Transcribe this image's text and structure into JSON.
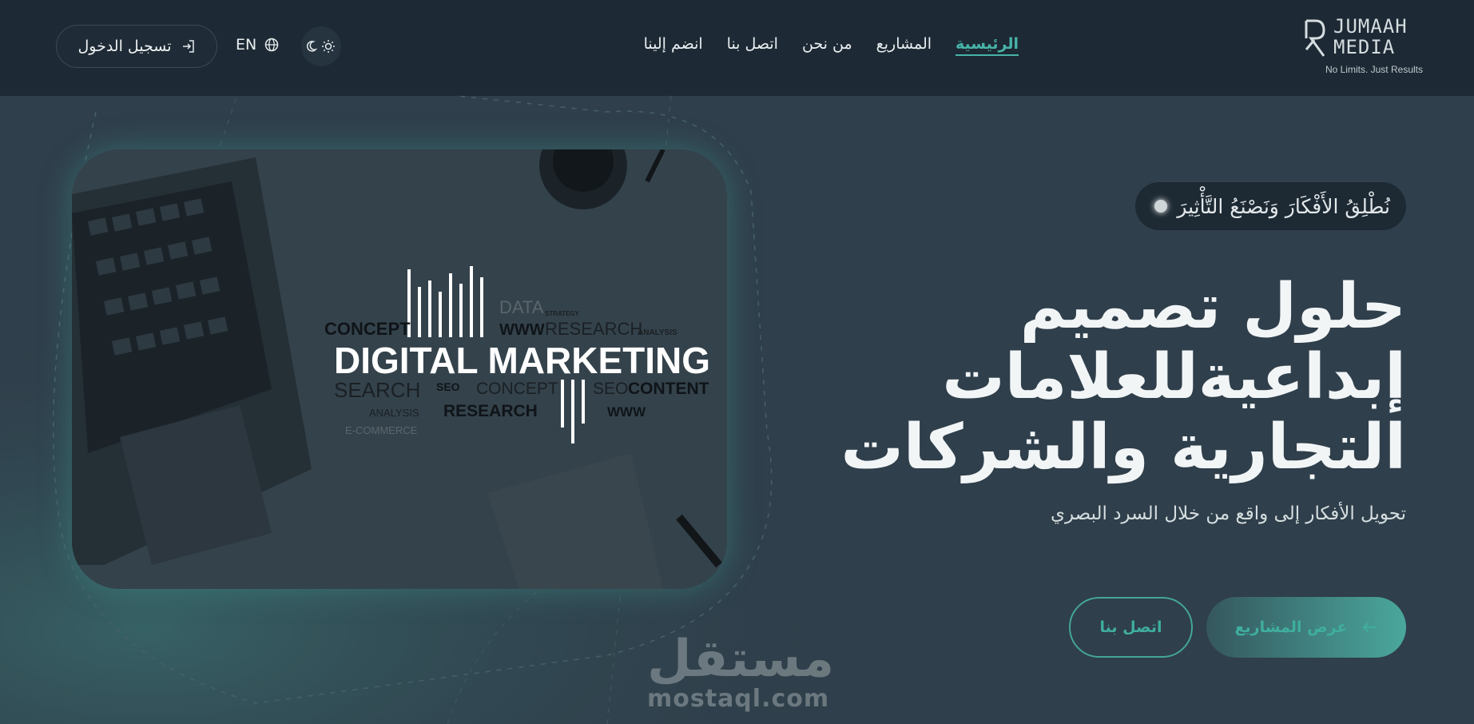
{
  "brand": {
    "name_line1": "JUMAAH",
    "name_line2": "MEDIA",
    "tagline": "No Limits. Just Results"
  },
  "nav": {
    "items": [
      {
        "label": "الرئيسية",
        "active": true
      },
      {
        "label": "المشاريع"
      },
      {
        "label": "من نحن"
      },
      {
        "label": "اتصل بنا"
      },
      {
        "label": "انضم إلينا"
      }
    ],
    "language": "EN",
    "login_label": "تسجيل الدخول"
  },
  "hero": {
    "badge": "نُطْلِقُ الأَفْكَارَ وَنَصْنَعُ التَّأْثِيرَ",
    "title_lines": [
      "حلول تصميم",
      "إبداعيةللعلامات",
      "التجارية والشركات"
    ],
    "subtitle": "تحويل الأفكار إلى واقع من خلال السرد البصري",
    "primary_button": "عرض المشاريع",
    "secondary_button": "اتصل بنا"
  },
  "image": {
    "headline": "DIGITAL MARKETING",
    "words": {
      "concept1": "CONCEPT",
      "data": "DATA",
      "strategy": "STRATEGY",
      "www1": "WWW",
      "research1": "RESEARCH",
      "analysis1": "ANALYSIS",
      "search": "SEARCH",
      "seo1": "SEO",
      "concept2": "CONCEPT",
      "seo2": "SEO",
      "content": "CONTENT",
      "analysis2": "ANALYSIS",
      "research2": "RESEARCH",
      "www2": "WWW",
      "ecommerce": "E-COMMERCE"
    }
  },
  "watermark": {
    "arabic": "مستقل",
    "latin": "mostaql.com"
  },
  "colors": {
    "accent": "#48b3a8",
    "nav_bg": "#1d2934",
    "page_bg": "#2f3f4b"
  }
}
